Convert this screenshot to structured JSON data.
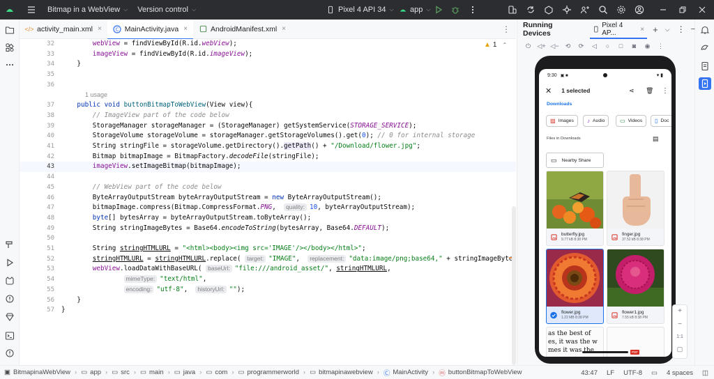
{
  "topbar": {
    "project": "Bitmap in a WebView",
    "vcs": "Version control",
    "device": "Pixel 4 API 34",
    "run_config": "app"
  },
  "tabs": [
    {
      "label": "activity_main.xml",
      "icon": "xml-icon",
      "active": false
    },
    {
      "label": "MainActivity.java",
      "icon": "java-class-icon",
      "active": true
    },
    {
      "label": "AndroidManifest.xml",
      "icon": "manifest-icon",
      "active": false
    }
  ],
  "editor": {
    "warning_count": "1",
    "usage_label": "1 usage",
    "line_numbers": [
      "32",
      "33",
      "34",
      "35",
      "36",
      "37",
      "38",
      "39",
      "40",
      "41",
      "42",
      "43",
      "44",
      "45",
      "46",
      "47",
      "48",
      "49",
      "50",
      "51",
      "52",
      "53",
      "54",
      "55",
      "56",
      "57"
    ],
    "current_line": "43",
    "hints": {
      "quality": "quality:",
      "target": "target:",
      "replacement": "replacement:",
      "baseUrl": "baseUrl:",
      "mimeType": "mimeType:",
      "encoding": "encoding:",
      "historyUrl": "historyUrl:"
    }
  },
  "running_devices": {
    "title": "Running Devices",
    "device_tab": "Pixel 4 AP..."
  },
  "phone": {
    "time": "9:30",
    "app_title": "1 selected",
    "section": "Downloads",
    "chips": [
      "Images",
      "Audio",
      "Videos",
      "Doc"
    ],
    "files_label": "Files in Downloads",
    "nearby_share": "Nearby Share",
    "files": [
      {
        "name": "butterfly.jpg",
        "meta": "9.77 kB 8:38 PM",
        "selected": false
      },
      {
        "name": "finger.jpg",
        "meta": "37.52 kB 8:38 PM",
        "selected": false
      },
      {
        "name": "flower.jpg",
        "meta": "1.22 MB 8:38 PM",
        "selected": true
      },
      {
        "name": "flower1.jpg",
        "meta": "7.55 kB 8:38 PM",
        "selected": false
      }
    ],
    "doc_preview": [
      "as the best of",
      "es, it was the w",
      "mes  it was the"
    ],
    "pdf_badge": "PDF"
  },
  "zoom": {
    "plus": "+",
    "minus": "−",
    "ratio": "1:1"
  },
  "statusbar": {
    "breadcrumbs": [
      "BitmapinaWebView",
      "app",
      "src",
      "main",
      "java",
      "com",
      "programmerworld",
      "bitmapinawebview",
      "MainActivity",
      "buttonBitmapToWebView"
    ],
    "position": "43:47",
    "line_sep": "LF",
    "encoding": "UTF-8",
    "indent": "4 spaces"
  }
}
